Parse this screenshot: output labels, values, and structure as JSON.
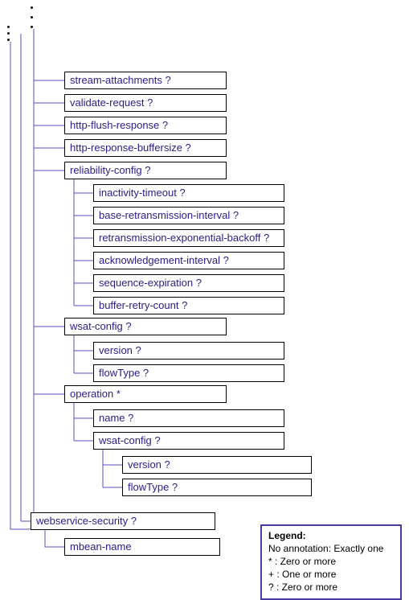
{
  "nodes": {
    "stream_attachments": "stream-attachments ?",
    "validate_request": "validate-request ?",
    "http_flush_response": "http-flush-response ?",
    "http_response_buffersize": "http-response-buffersize ?",
    "reliability_config": "reliability-config ?",
    "inactivity_timeout": "inactivity-timeout ?",
    "base_retransmission_interval": "base-retransmission-interval ?",
    "retransmission_exponential_backoff": "retransmission-exponential-backoff ?",
    "acknowledgement_interval": "acknowledgement-interval ?",
    "sequence_expiration": "sequence-expiration ?",
    "buffer_retry_count": "buffer-retry-count ?",
    "wsat_config": "wsat-config ?",
    "version": "version ?",
    "flowType": "flowType ?",
    "operation": "operation *",
    "name": "name ?",
    "wsat_config2": "wsat-config ?",
    "version2": "version ?",
    "flowType2": "flowType ?",
    "webservice_security": "webservice-security ?",
    "mbean_name": "mbean-name"
  },
  "legend": {
    "title": "Legend:",
    "line1": "No annotation: Exactly one",
    "line2": "* : Zero or more",
    "line3": "+ : One or more",
    "line4": "? : Zero or more"
  }
}
